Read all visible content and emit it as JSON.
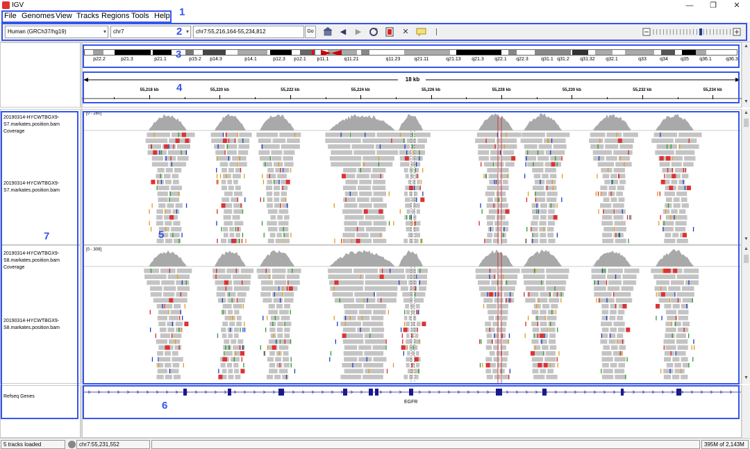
{
  "window": {
    "title": "IGV",
    "minimize": "—",
    "restore": "❐",
    "close": "✕"
  },
  "menu": [
    "File",
    "Genomes",
    "View",
    "Tracks",
    "Regions",
    "Tools",
    "Help"
  ],
  "toolbar": {
    "genome": "Human (GRCh37/hg19)",
    "chromosome": "chr7",
    "locus": "chr7:55,216,164-55,234,812",
    "go_label": "Go"
  },
  "ideogram": {
    "labels": [
      "p22.2",
      "p21.3",
      "p21.1",
      "p15.2",
      "p14.3",
      "p14.1",
      "p12.3",
      "p12.1",
      "p11.1",
      "q11.21",
      "q11.23",
      "q21.11",
      "q21.13",
      "q21.3",
      "q22.1",
      "q22.3",
      "q31.1",
      "q31.2",
      "q31.32",
      "q32.1",
      "q33",
      "q34",
      "q35",
      "q36.1",
      "q36.3"
    ]
  },
  "ruler": {
    "span": "18 kb",
    "ticks": [
      "55,218 kb",
      "55,220 kb",
      "55,222 kb",
      "55,224 kb",
      "55,226 kb",
      "55,228 kb",
      "55,230 kb",
      "55,232 kb",
      "55,234 kb"
    ]
  },
  "tracks": [
    {
      "coverage_name": "20190314-HYCWTBGX9-S7.markates.position.bam Coverage",
      "bam_name": "20190314-HYCWTBGX9-S7.markates.position.bam",
      "range": "[0 - 280]"
    },
    {
      "coverage_name": "20190314-HYCWTBGX9-S8.markates.position.bam Coverage",
      "bam_name": "20190314-HYCWTBGX9-S8.markates.position.bam",
      "range": "[0 - 309]"
    }
  ],
  "genes": {
    "track_name": "Refseq Genes",
    "gene_label": "EGFR"
  },
  "status": {
    "tracks_loaded": "5 tracks loaded",
    "position": "chr7:55,231,552",
    "memory": "395M of 2,143M"
  },
  "annotations": [
    "1",
    "2",
    "3",
    "4",
    "5",
    "6",
    "7"
  ],
  "colors": {
    "annotation": "#3355ee",
    "coverage": "#a9a9a9",
    "read": "#c4c4c4",
    "gene": "#1a1a8c",
    "centromere": "#cc0000"
  }
}
